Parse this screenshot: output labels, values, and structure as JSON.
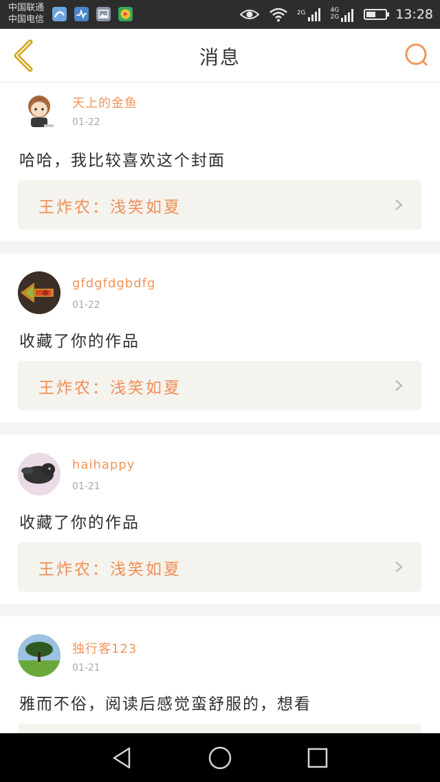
{
  "status_bar": {
    "carrier_1": "中国联通",
    "carrier_2": "中国电信",
    "network_1": "2G",
    "network_2a": "4G",
    "network_2b": "2G",
    "battery_level": 0.5,
    "time": "13:28",
    "icons": [
      "app-icon-1",
      "app-icon-2",
      "app-icon-3",
      "app-icon-4",
      "eye-icon",
      "wifi-icon",
      "signal-icon",
      "battery-icon"
    ]
  },
  "header": {
    "title": "消息",
    "back_icon": "chevron-left-icon",
    "search_icon": "search-icon"
  },
  "colors": {
    "accent": "#f0955a",
    "back_icon": "#d2a21e",
    "ref_bg": "#f4f3ee",
    "gap": "#f4f4f4"
  },
  "messages": [
    {
      "username": "天上的金鱼",
      "date": "01-22",
      "content": "哈哈，我比较喜欢这个封面",
      "ref_author": "王炸农",
      "ref_separator": "：",
      "ref_title": "浅笑如夏"
    },
    {
      "username": "gfdgfdgbdfg",
      "date": "01-22",
      "content": "收藏了你的作品",
      "ref_author": "王炸农",
      "ref_separator": "：",
      "ref_title": "浅笑如夏"
    },
    {
      "username": "haihappy",
      "date": "01-21",
      "content": "收藏了你的作品",
      "ref_author": "王炸农",
      "ref_separator": "：",
      "ref_title": "浅笑如夏"
    },
    {
      "username": "独行客123",
      "date": "01-21",
      "content": "雅而不俗，阅读后感觉蛮舒服的，想看"
    }
  ],
  "nav_bar": {
    "icons": [
      "back-triangle-icon",
      "home-circle-icon",
      "recents-square-icon"
    ]
  }
}
